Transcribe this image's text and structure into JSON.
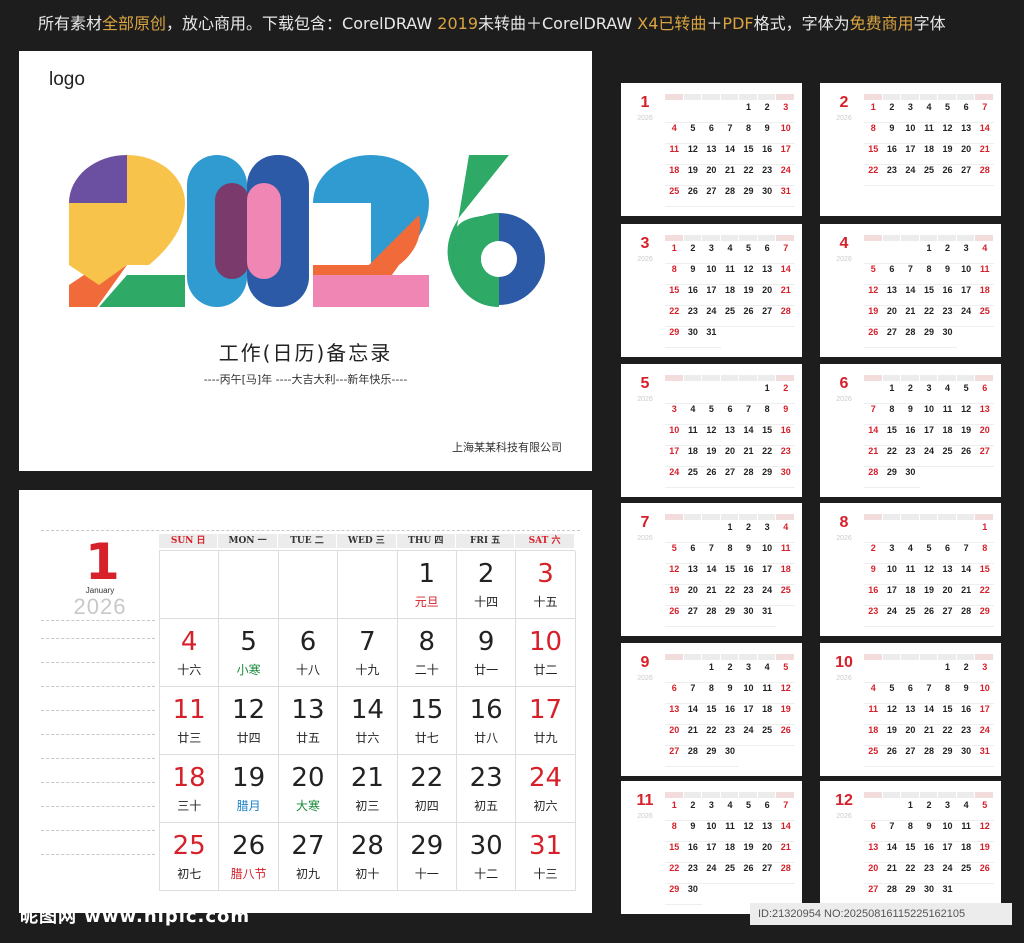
{
  "topbar": {
    "part1": "所有素材",
    "part2": "全部原创",
    "part3": "，放心商用。下载包含：CorelDRAW ",
    "part4": "2019",
    "part5": "未转曲＋CorelDRAW ",
    "part6": "X4已转曲",
    "part7": "＋",
    "part8": "PDF",
    "part9": "格式，字体为",
    "part10": "免费商用",
    "part11": "字体"
  },
  "cover": {
    "logo": "logo",
    "year": "2026",
    "title": "工作(日历)备忘录",
    "subtitle": "----丙午[马]年 ----大吉大利---新年快乐----",
    "company": "上海某某科技有限公司"
  },
  "january": {
    "month_number": "1",
    "month_name": "January",
    "year": "2026",
    "weekdays": [
      "SUN 日",
      "MON 一",
      "TUE 二",
      "WED 三",
      "THU 四",
      "FRI 五",
      "SAT 六"
    ],
    "cells": [
      {
        "d": "",
        "l": ""
      },
      {
        "d": "",
        "l": ""
      },
      {
        "d": "",
        "l": ""
      },
      {
        "d": "",
        "l": ""
      },
      {
        "d": "1",
        "l": "元旦",
        "lc": "red"
      },
      {
        "d": "2",
        "l": "十四"
      },
      {
        "d": "3",
        "l": "十五",
        "dc": "red"
      },
      {
        "d": "4",
        "l": "十六",
        "dc": "red"
      },
      {
        "d": "5",
        "l": "小寒",
        "lc": "grn"
      },
      {
        "d": "6",
        "l": "十八"
      },
      {
        "d": "7",
        "l": "十九"
      },
      {
        "d": "8",
        "l": "二十"
      },
      {
        "d": "9",
        "l": "廿一"
      },
      {
        "d": "10",
        "l": "廿二",
        "dc": "red"
      },
      {
        "d": "11",
        "l": "廿三",
        "dc": "red"
      },
      {
        "d": "12",
        "l": "廿四"
      },
      {
        "d": "13",
        "l": "廿五"
      },
      {
        "d": "14",
        "l": "廿六"
      },
      {
        "d": "15",
        "l": "廿七"
      },
      {
        "d": "16",
        "l": "廿八"
      },
      {
        "d": "17",
        "l": "廿九",
        "dc": "red"
      },
      {
        "d": "18",
        "l": "三十",
        "dc": "red"
      },
      {
        "d": "19",
        "l": "腊月",
        "lc": "blu"
      },
      {
        "d": "20",
        "l": "大寒",
        "lc": "grn"
      },
      {
        "d": "21",
        "l": "初三"
      },
      {
        "d": "22",
        "l": "初四"
      },
      {
        "d": "23",
        "l": "初五"
      },
      {
        "d": "24",
        "l": "初六",
        "dc": "red"
      },
      {
        "d": "25",
        "l": "初七",
        "dc": "red"
      },
      {
        "d": "26",
        "l": "腊八节",
        "lc": "red"
      },
      {
        "d": "27",
        "l": "初九"
      },
      {
        "d": "28",
        "l": "初十"
      },
      {
        "d": "29",
        "l": "十一"
      },
      {
        "d": "30",
        "l": "十二"
      },
      {
        "d": "31",
        "l": "十三",
        "dc": "red"
      }
    ]
  },
  "thumbs": {
    "year": "2026",
    "months": [
      {
        "n": "1",
        "start": 4,
        "days": 31
      },
      {
        "n": "2",
        "start": 0,
        "days": 28
      },
      {
        "n": "3",
        "start": 0,
        "days": 31
      },
      {
        "n": "4",
        "start": 3,
        "days": 30
      },
      {
        "n": "5",
        "start": 5,
        "days": 31
      },
      {
        "n": "6",
        "start": 1,
        "days": 30
      },
      {
        "n": "7",
        "start": 3,
        "days": 31
      },
      {
        "n": "8",
        "start": 6,
        "days": 31
      },
      {
        "n": "9",
        "start": 2,
        "days": 30
      },
      {
        "n": "10",
        "start": 4,
        "days": 31
      },
      {
        "n": "11",
        "start": 0,
        "days": 30
      },
      {
        "n": "12",
        "start": 2,
        "days": 31
      }
    ]
  },
  "watermark": {
    "left": "昵图网 www.nipic.com",
    "right": "ID:21320954 NO:20250816115225162105"
  },
  "colors": {
    "accent_red": "#d6202a",
    "solar_term_green": "#1a8a3c",
    "festival_blue": "#1c82c8"
  }
}
